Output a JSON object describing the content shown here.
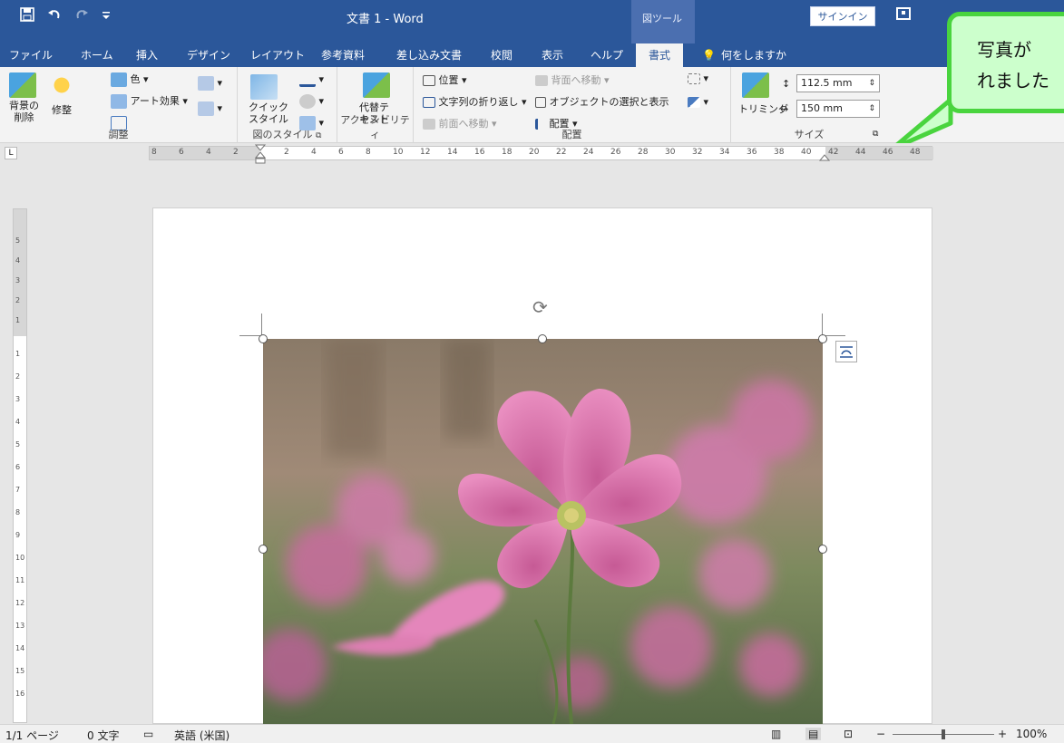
{
  "titlebar": {
    "title": "文書 1 - Word",
    "context_tab": "図ツール",
    "signin_label": "サインイン",
    "quick_access": [
      "save-icon",
      "undo-icon",
      "redo-icon",
      "customize-icon"
    ]
  },
  "tabs": {
    "file": "ファイル",
    "home": "ホーム",
    "insert": "挿入",
    "design": "デザイン",
    "layout": "レイアウト",
    "references": "参考資料",
    "mailings": "差し込み文書",
    "review": "校閲",
    "view": "表示",
    "help": "ヘルプ",
    "format": "書式",
    "tell_me": "何をしますか"
  },
  "ribbon": {
    "remove_bg_1": "背景の",
    "remove_bg_2": "削除",
    "corrections": "修整",
    "color": "色",
    "artistic": "アート効果",
    "adjust_group": "調整",
    "quick_styles_1": "クイック",
    "quick_styles_2": "スタイル",
    "styles_group": "図のスタイル",
    "alt_text_1": "代替テ",
    "alt_text_2": "キスト",
    "accessibility_group": "アクセシビリティ",
    "position": "位置",
    "wrap_text": "文字列の折り返し",
    "bring_forward": "前面へ移動",
    "send_backward": "背面へ移動",
    "selection_pane": "オブジェクトの選択と表示",
    "align": "配置",
    "arrange_group": "配置",
    "crop": "トリミング",
    "height": "112.5 mm",
    "width": "150 mm",
    "size_group": "サイズ"
  },
  "callout": {
    "text": "写真が\nれました"
  },
  "ruler": {
    "h_ticks": [
      "8",
      "6",
      "4",
      "2",
      "2",
      "4",
      "6",
      "8",
      "10",
      "12",
      "14",
      "16",
      "18",
      "20",
      "22",
      "24",
      "26",
      "28",
      "30",
      "32",
      "34",
      "36",
      "38",
      "40",
      "42",
      "44",
      "46",
      "48"
    ],
    "v_ticks": [
      "5",
      "4",
      "3",
      "2",
      "1",
      "1",
      "2",
      "3",
      "4",
      "5",
      "6",
      "7",
      "8",
      "9",
      "10",
      "11",
      "12",
      "13",
      "14",
      "15",
      "16"
    ],
    "corner": "L"
  },
  "status": {
    "page": "1/1 ページ",
    "words": "0 文字",
    "language": "英語 (米国)",
    "zoom": "100%"
  },
  "colors": {
    "accent": "#2b579a",
    "callout_fill": "#ccffcc",
    "callout_border": "#49d43e"
  }
}
